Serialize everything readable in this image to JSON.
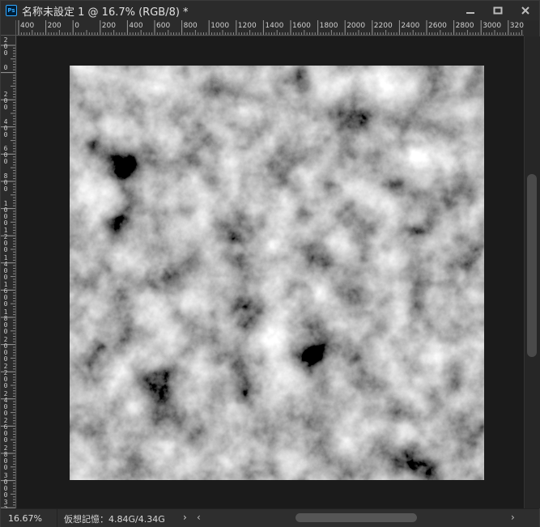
{
  "titlebar": {
    "app_badge": "Ps",
    "document_title": "名称未設定 1 @ 16.7% (RGB/8) *",
    "minimize_icon": "minimize-icon",
    "restore_icon": "restore-icon",
    "close_icon": "close-icon"
  },
  "ruler_h": {
    "labels": [
      "400",
      "200",
      "0",
      "200",
      "400",
      "600",
      "800",
      "1000",
      "1200",
      "1400",
      "1600",
      "1800",
      "2000",
      "2200",
      "2400",
      "2600",
      "2800",
      "3000",
      "3200"
    ]
  },
  "ruler_v": {
    "labels": [
      "200",
      "0",
      "200",
      "400",
      "600",
      "800",
      "1000",
      "1200",
      "1400",
      "1600",
      "1800",
      "2000",
      "2200",
      "2400",
      "2600",
      "2800",
      "3000",
      "3200"
    ]
  },
  "canvas": {
    "filter": "clouds-texture",
    "colors": {
      "dark": "#1a1a1a",
      "light": "#e0e0e0",
      "workspace": "#1b1b1b"
    }
  },
  "statusbar": {
    "zoom": "16.67%",
    "info": "仮想記憶：4.84G/4.34G",
    "more_arrow": "›",
    "scroll_left": "‹",
    "scroll_right": "›"
  }
}
